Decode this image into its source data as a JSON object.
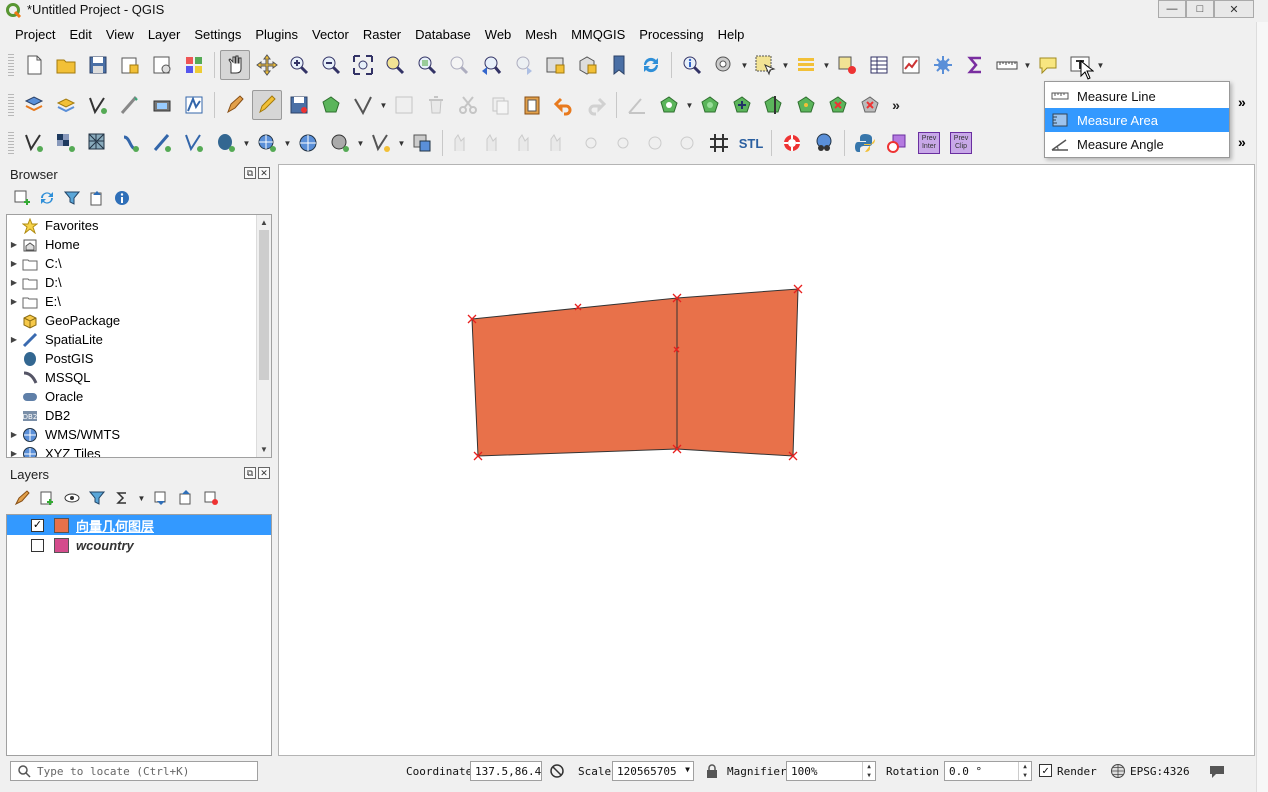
{
  "window": {
    "title": "*Untitled Project - QGIS"
  },
  "menubar": [
    "Project",
    "Edit",
    "View",
    "Layer",
    "Settings",
    "Plugins",
    "Vector",
    "Raster",
    "Database",
    "Web",
    "Mesh",
    "MMQGIS",
    "Processing",
    "Help"
  ],
  "toolbar3": {
    "prev_inter": "Prev\nInter",
    "prev_clip": "Prev\nClip",
    "stl": "STL"
  },
  "browser": {
    "title": "Browser",
    "items": [
      {
        "label": "Favorites",
        "icon": "star-icon",
        "expandable": false
      },
      {
        "label": "Home",
        "icon": "home-icon",
        "expandable": true
      },
      {
        "label": "C:\\",
        "icon": "folder-icon",
        "expandable": true
      },
      {
        "label": "D:\\",
        "icon": "folder-icon",
        "expandable": true
      },
      {
        "label": "E:\\",
        "icon": "folder-icon",
        "expandable": true
      },
      {
        "label": "GeoPackage",
        "icon": "geopackage-icon",
        "expandable": false
      },
      {
        "label": "SpatiaLite",
        "icon": "spatialite-icon",
        "expandable": true
      },
      {
        "label": "PostGIS",
        "icon": "postgis-icon",
        "expandable": false
      },
      {
        "label": "MSSQL",
        "icon": "mssql-icon",
        "expandable": false
      },
      {
        "label": "Oracle",
        "icon": "oracle-icon",
        "expandable": false
      },
      {
        "label": "DB2",
        "icon": "db2-icon",
        "expandable": false
      },
      {
        "label": "WMS/WMTS",
        "icon": "globe-icon",
        "expandable": true
      },
      {
        "label": "XYZ Tiles",
        "icon": "globe-icon",
        "expandable": true
      }
    ]
  },
  "layers": {
    "title": "Layers",
    "items": [
      {
        "name": "向量几何图层",
        "checked": true,
        "selected": true,
        "color": "#e8714a"
      },
      {
        "name": "wcountry",
        "checked": false,
        "selected": false,
        "color": "#d44c8c"
      }
    ]
  },
  "measure_menu": {
    "items": [
      {
        "label": "Measure Line",
        "highlighted": false
      },
      {
        "label": "Measure Area",
        "highlighted": true
      },
      {
        "label": "Measure Angle",
        "highlighted": false
      }
    ]
  },
  "statusbar": {
    "locate_placeholder": "Type to locate (Ctrl+K)",
    "coordinate_label": "Coordinate",
    "coordinate_value": "137.5,86.4",
    "scale_label": "Scale",
    "scale_value": "120565705",
    "magnifier_label": "Magnifier",
    "magnifier_value": "100%",
    "rotation_label": "Rotation",
    "rotation_value": "0.0 °",
    "render_label": "Render",
    "render_checked": true,
    "crs": "EPSG:4326"
  },
  "colors": {
    "polygon_fill": "#e8714a",
    "vertex_marker": "#e8201e",
    "selection": "#3399ff"
  }
}
